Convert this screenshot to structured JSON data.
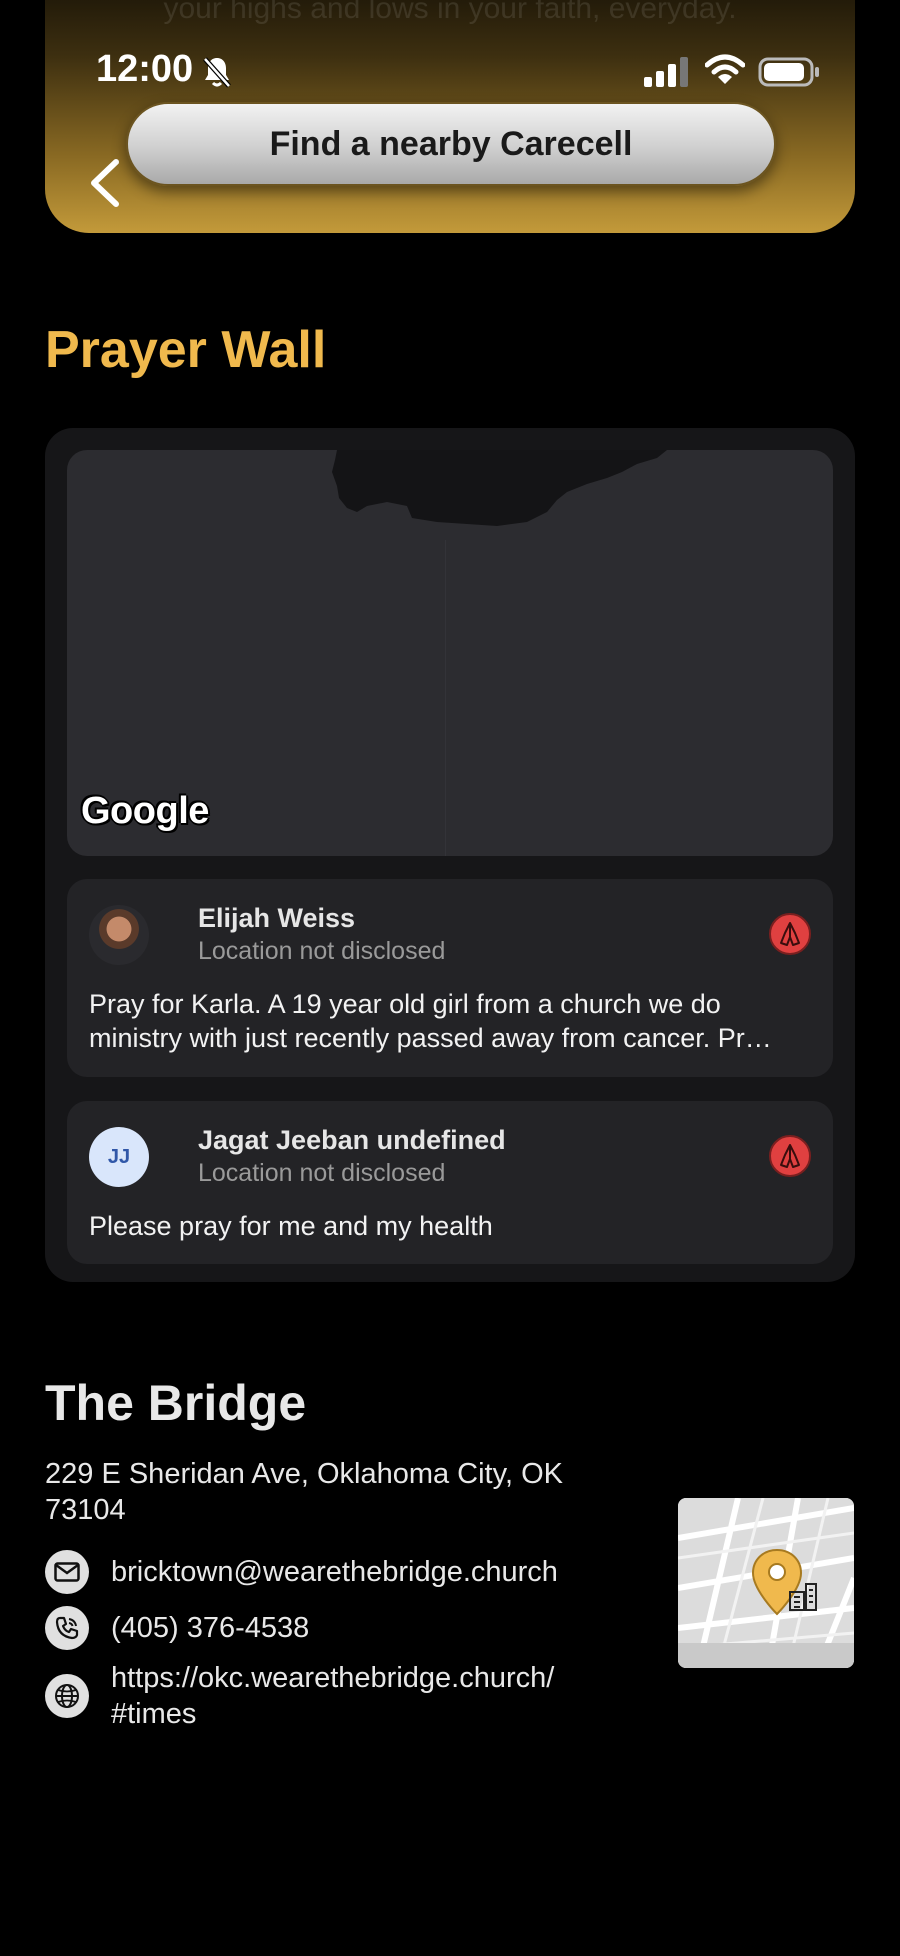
{
  "header": {
    "ghost_text": "your highs and lows in your faith, everyday.",
    "find_button_label": "Find a nearby Carecell"
  },
  "status_bar": {
    "time": "12:00"
  },
  "prayer_wall": {
    "title": "Prayer Wall",
    "map_attribution": "Google",
    "posts": [
      {
        "name": "Elijah Weiss",
        "location": "Location not disclosed",
        "text": "Pray for Karla. A 19 year old girl from a church we do ministry with  just recently passed away from cancer. Pr…"
      },
      {
        "name": "Jagat Jeeban undefined",
        "initials": "JJ",
        "location": "Location not disclosed",
        "text": "Please pray for me and my health"
      }
    ]
  },
  "church": {
    "name": "The Bridge",
    "address": "229 E Sheridan Ave, Oklahoma City, OK 73104",
    "email": "bricktown@wearethebridge.church",
    "phone": "(405) 376-4538",
    "website": "https://okc.wearethebridge.church/ #times"
  },
  "colors": {
    "accent_gold": "#f0b94d",
    "pray_button_red": "#e04040",
    "card_bg": "#232326"
  }
}
